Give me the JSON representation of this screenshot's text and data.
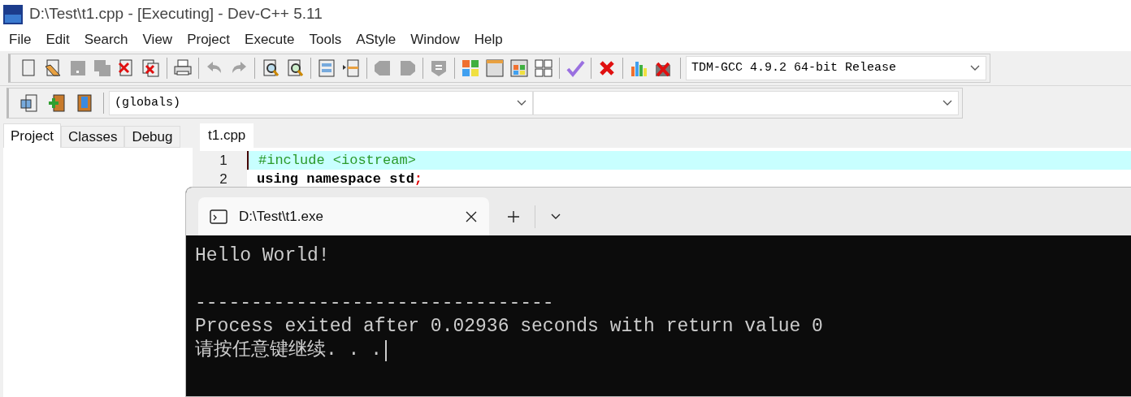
{
  "window": {
    "title": "D:\\Test\\t1.cpp - [Executing] - Dev-C++ 5.11"
  },
  "menu": [
    "File",
    "Edit",
    "Search",
    "View",
    "Project",
    "Execute",
    "Tools",
    "AStyle",
    "Window",
    "Help"
  ],
  "toolbar": {
    "groups": [
      [
        {
          "kind": "new",
          "disabled": false
        },
        {
          "kind": "open",
          "disabled": false
        },
        {
          "kind": "save",
          "disabled": true
        },
        {
          "kind": "save-all",
          "disabled": true
        },
        {
          "kind": "close",
          "disabled": false
        },
        {
          "kind": "close-all",
          "disabled": false
        }
      ],
      [
        {
          "kind": "print",
          "disabled": false
        }
      ],
      [
        {
          "kind": "undo",
          "disabled": true
        },
        {
          "kind": "redo",
          "disabled": true
        }
      ],
      [
        {
          "kind": "find",
          "disabled": false
        },
        {
          "kind": "replace",
          "disabled": false
        }
      ],
      [
        {
          "kind": "goto",
          "disabled": false
        },
        {
          "kind": "bookmark",
          "disabled": false
        }
      ],
      [
        {
          "kind": "indent",
          "disabled": true
        },
        {
          "kind": "unindent",
          "disabled": true
        }
      ],
      [
        {
          "kind": "comment",
          "disabled": true
        }
      ],
      [
        {
          "kind": "compile",
          "disabled": false
        },
        {
          "kind": "run",
          "disabled": false
        },
        {
          "kind": "compile-run",
          "disabled": false
        },
        {
          "kind": "rebuild",
          "disabled": false
        }
      ],
      [
        {
          "kind": "check",
          "disabled": false
        }
      ],
      [
        {
          "kind": "stop",
          "disabled": false
        }
      ],
      [
        {
          "kind": "profile",
          "disabled": false
        },
        {
          "kind": "delete-profile",
          "disabled": false
        }
      ]
    ],
    "compiler": "TDM-GCC 4.9.2 64-bit Release"
  },
  "toolbar2": {
    "icons": [
      {
        "kind": "new-project"
      },
      {
        "kind": "add-file"
      },
      {
        "kind": "class"
      }
    ],
    "scope": "(globals)"
  },
  "left_tabs": [
    {
      "label": "Project",
      "selected": true
    },
    {
      "label": "Classes",
      "selected": false
    },
    {
      "label": "Debug",
      "selected": false
    }
  ],
  "editor_tabs": [
    {
      "label": "t1.cpp",
      "selected": true
    }
  ],
  "code_lines": [
    {
      "number": "1",
      "current": true,
      "tokens": [
        {
          "text": "#include <iostream>",
          "kind": "preprocessor"
        }
      ]
    },
    {
      "number": "2",
      "current": false,
      "tokens": [
        {
          "text": "using namespace std",
          "kind": "keyword"
        },
        {
          "text": ";",
          "kind": "symbol"
        }
      ]
    }
  ],
  "terminal": {
    "tab": "D:\\Test\\t1.exe",
    "lines": [
      {
        "kind": "text",
        "text": "Hello World!",
        "cursor": false
      },
      {
        "kind": "blank"
      },
      {
        "kind": "text",
        "text": "--------------------------------",
        "cursor": false
      },
      {
        "kind": "text",
        "text": "Process exited after 0.02936 seconds with return value 0",
        "cursor": false
      },
      {
        "kind": "text",
        "text": "请按任意键继续. . .",
        "cursor": true
      }
    ]
  }
}
